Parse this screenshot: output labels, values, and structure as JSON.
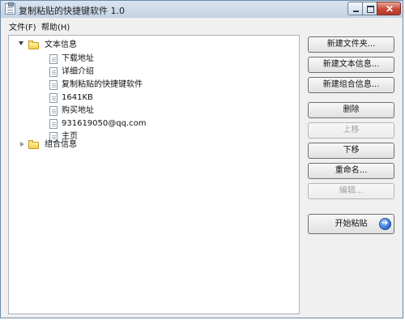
{
  "window": {
    "title": "复制粘贴的快捷键软件 1.0"
  },
  "menu": [
    {
      "label": "文件(F)"
    },
    {
      "label": "帮助(H)"
    }
  ],
  "tree": {
    "folders": [
      {
        "label": "文本信息",
        "expanded": true,
        "items": [
          "下载地址",
          "详细介绍",
          "复制粘贴的快捷键软件",
          "1641KB",
          "购买地址",
          "931619050@qq.com",
          "主页"
        ]
      },
      {
        "label": "组合信息",
        "expanded": false,
        "items": []
      }
    ]
  },
  "buttons": {
    "new_folder": "新建文件夹...",
    "new_text": "新建文本信息...",
    "new_combo": "新建组合信息...",
    "delete": "删除",
    "move_up": "上移",
    "move_down": "下移",
    "rename": "重命名...",
    "edit": "编辑...",
    "start_paste": "开始粘贴"
  }
}
